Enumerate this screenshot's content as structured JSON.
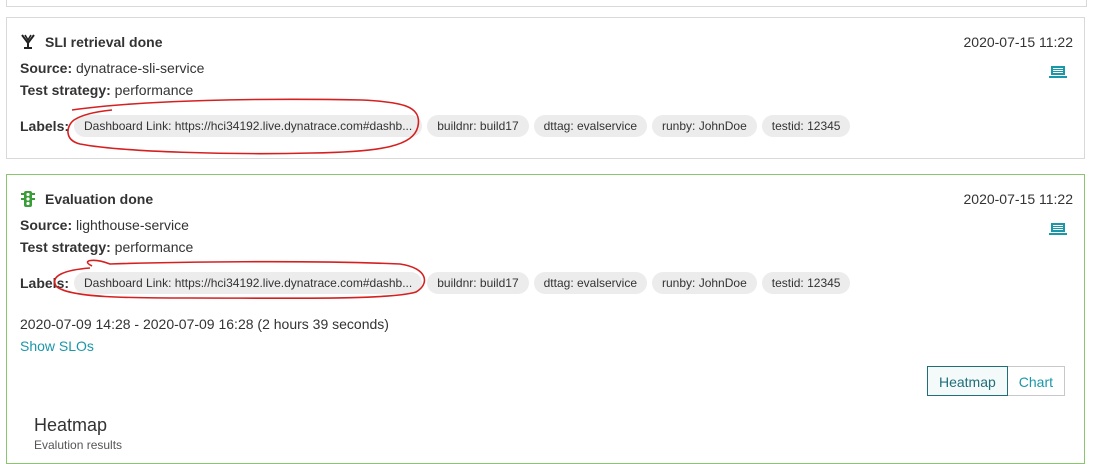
{
  "events": [
    {
      "title": "SLI retrieval done",
      "timestamp": "2020-07-15 11:22",
      "source_key": "Source:",
      "source_value": "dynatrace-sli-service",
      "strategy_key": "Test strategy:",
      "strategy_value": "performance",
      "labels_key": "Labels:",
      "labels": [
        "Dashboard Link: https://hci34192.live.dynatrace.com#dashb...",
        "buildnr: build17",
        "dttag: evalservice",
        "runby: JohnDoe",
        "testid: 12345"
      ],
      "icon": "sli-fork-icon",
      "side_icon": "laptop-icon"
    },
    {
      "title": "Evaluation done",
      "timestamp": "2020-07-15 11:22",
      "source_key": "Source:",
      "source_value": "lighthouse-service",
      "strategy_key": "Test strategy:",
      "strategy_value": "performance",
      "labels_key": "Labels:",
      "labels": [
        "Dashboard Link: https://hci34192.live.dynatrace.com#dashb...",
        "buildnr: build17",
        "dttag: evalservice",
        "runby: JohnDoe",
        "testid: 12345"
      ],
      "icon": "traffic-light-icon",
      "side_icon": "laptop-icon",
      "time_range": "2020-07-09 14:28 - 2020-07-09 16:28 (2 hours 39 seconds)",
      "show_slos": "Show SLOs",
      "view_buttons": [
        "Heatmap",
        "Chart"
      ],
      "active_view": "Heatmap",
      "heatmap_title": "Heatmap",
      "heatmap_subtitle": "Evalution results"
    }
  ],
  "colors": {
    "accent": "#1a97a8",
    "success_border": "#8cc56f",
    "chip_bg": "#ececec",
    "annotation": "#d62020"
  }
}
